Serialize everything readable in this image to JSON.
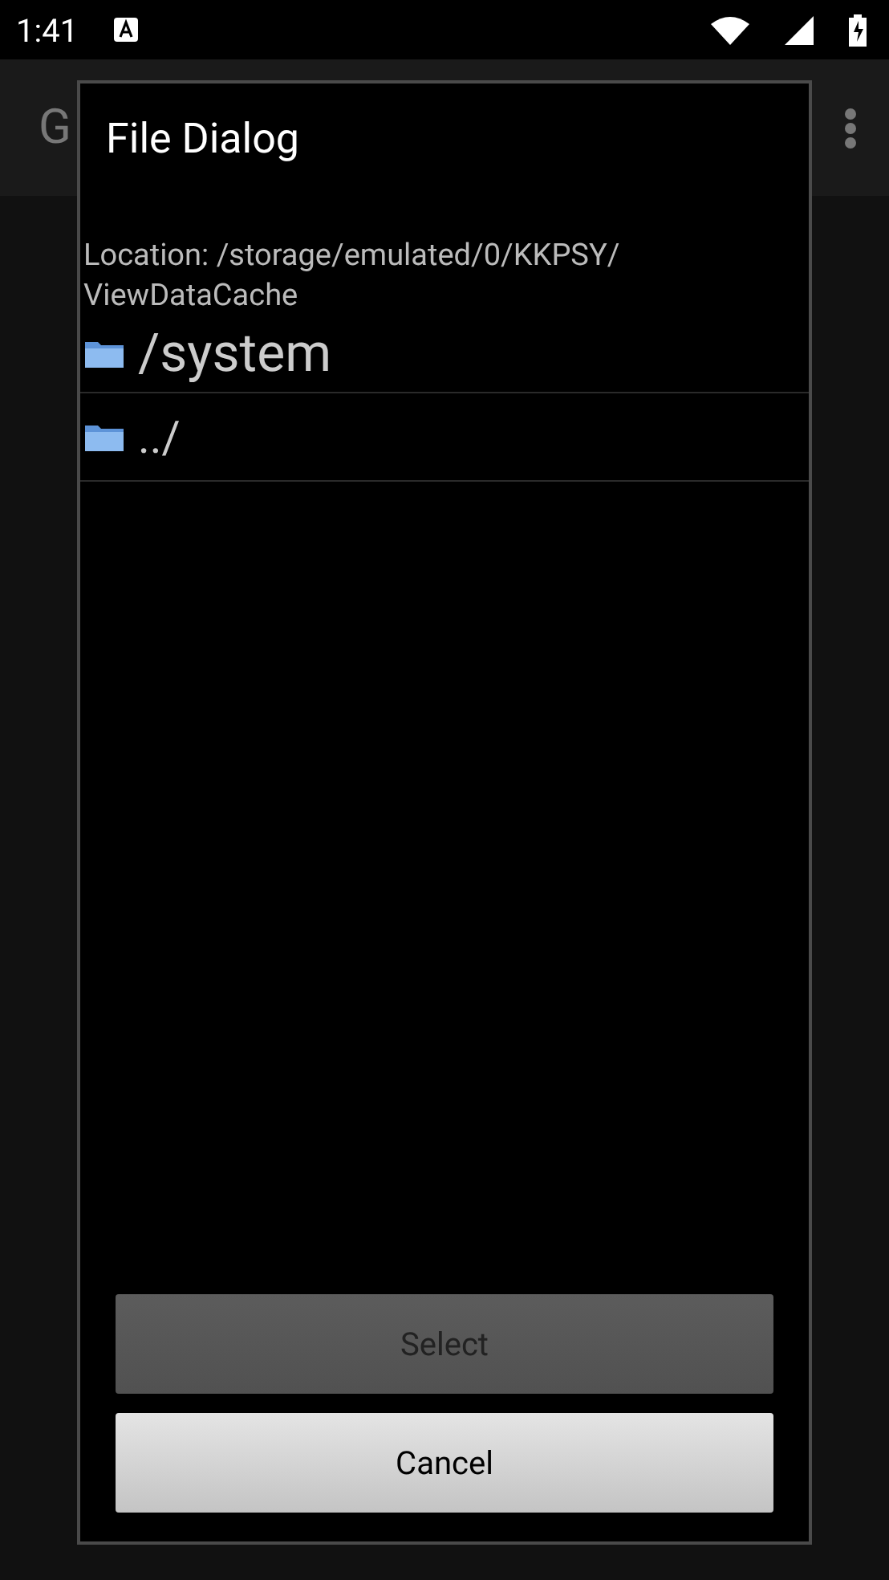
{
  "status_bar": {
    "time": "1:41"
  },
  "app_bar": {
    "title": "G"
  },
  "dialog": {
    "title": "File Dialog",
    "location": "Location: /storage/emulated/0/KKPSY/\nViewDataCache",
    "items": [
      {
        "name": "/system",
        "kind": "root"
      },
      {
        "name": "../",
        "kind": "parent"
      }
    ],
    "buttons": [
      {
        "label": "Select",
        "disabled": true
      },
      {
        "label": "Cancel",
        "disabled": false
      }
    ]
  }
}
